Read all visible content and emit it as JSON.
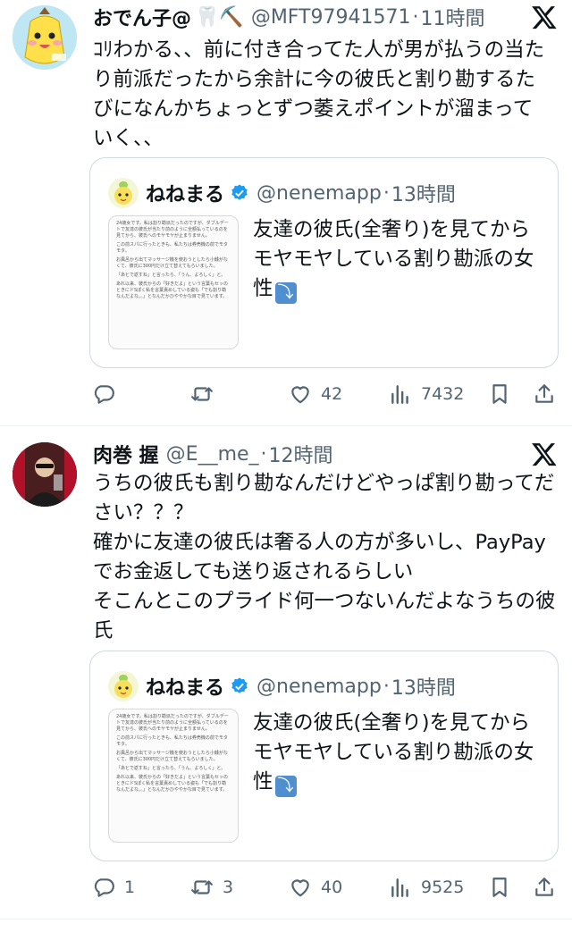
{
  "tweets": [
    {
      "name": "おでん子@",
      "emoji": "🦷⛏️",
      "handle": "@MFT97941571",
      "time": "11時間",
      "text": "ｺﾘわかる、、前に付き合ってた人が男が払うの当たり前派だったから余計に今の彼氏と割り勘するたびになんかちょっとずつ萎えポイントが溜まっていく、、",
      "quote": {
        "name": "ねねまる",
        "handle": "@nenemapp",
        "time": "13時間",
        "text": "友達の彼氏(全奢り)を見てからモヤモヤしている割り勘派の女性",
        "thumb_lines": [
          "24歳女です。私は割り勘派だったのですが、ダブルデートで友達の彼氏が当たり前のように全額払っているのを見てから、彼氏へのモヤモヤが止まりません。",
          "この前スパに行ったときも、私たちは券売機の前でモタモタ。",
          "お風呂から出てマッサージ機を使おうとしたら小銭がなくて、彼氏に300円だけ立て替えてもらいました。",
          "「あとで返すね」と言ったら、「うん、よろしく」と。",
          "あれ以来、彼氏からの「好きだよ」という言葉もセッのときにドSぽく私を言葉責めしている姿も「でも割り勘なんだよな。。」となんだかひややかな目で見ています。"
        ]
      },
      "actions": {
        "reply": "",
        "retweet": "",
        "like": "42",
        "views": "7432"
      }
    },
    {
      "name": "肉巻 握",
      "emoji": "",
      "handle": "@E__me_",
      "time": "12時間",
      "text": "うちの彼氏も割り勘なんだけどやっぱ割り勘ってださい？？？\n確かに友達の彼氏は奢る人の方が多いし、PayPayでお金返しても送り返されるらしい\nそこんとこのプライド何一つないんだよなうちの彼氏",
      "quote": {
        "name": "ねねまる",
        "handle": "@nenemapp",
        "time": "13時間",
        "text": "友達の彼氏(全奢り)を見てからモヤモヤしている割り勘派の女性",
        "thumb_lines": [
          "24歳女です。私は割り勘派だったのですが、ダブルデートで友達の彼氏が当たり前のように全額払っているのを見てから、彼氏へのモヤモヤが止まりません。",
          "この前スパに行ったときも、私たちは券売機の前でモタモタ。",
          "お風呂から出てマッサージ機を使おうとしたら小銭がなくて、彼氏に300円だけ立て替えてもらいました。",
          "「あとで返すね」と言ったら、「うん、よろしく」と。",
          "あれ以来、彼氏からの「好きだよ」という言葉もセッのときにドSぽく私を言葉責めしている姿も「でも割り勘なんだよな。。」となんだかひややかな目で見ています。"
        ]
      },
      "actions": {
        "reply": "1",
        "retweet": "3",
        "like": "40",
        "views": "9525"
      }
    }
  ],
  "separator": "·",
  "colors": {
    "text": "#0f1419",
    "secondary": "#536471",
    "border": "#cfd9de",
    "verified": "#1d9bf0"
  }
}
